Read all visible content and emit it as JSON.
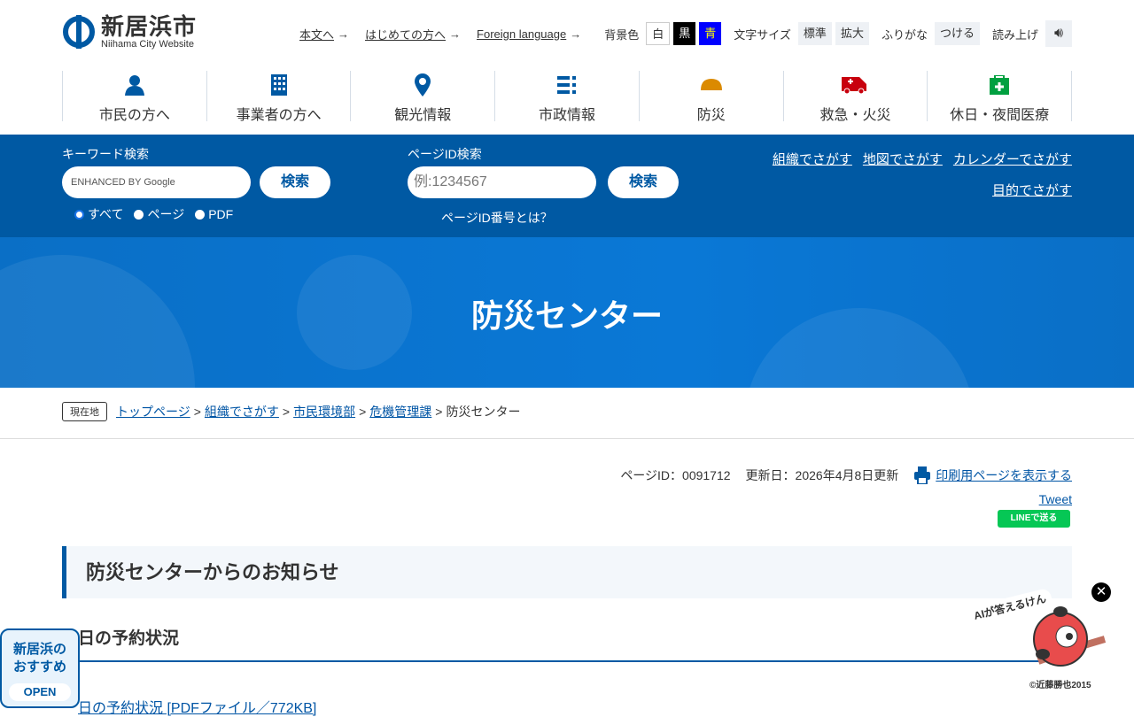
{
  "header": {
    "logo_title": "新居浜市",
    "logo_sub": "Niihama City Website",
    "util_links": [
      "本文へ",
      "はじめての方へ",
      "Foreign language"
    ],
    "bg_label": "背景色",
    "bg_options": [
      "白",
      "黒",
      "青"
    ],
    "size_label": "文字サイズ",
    "size_options": [
      "標準",
      "拡大"
    ],
    "furigana_label": "ふりがな",
    "furigana_btn": "つける",
    "read_label": "読み上げ"
  },
  "gnav": [
    {
      "label": "市民の方へ",
      "icon": "person-icon"
    },
    {
      "label": "事業者の方へ",
      "icon": "building-icon"
    },
    {
      "label": "観光情報",
      "icon": "map-pin-icon"
    },
    {
      "label": "市政情報",
      "icon": "list-icon"
    },
    {
      "label": "防災",
      "icon": "helmet-icon"
    },
    {
      "label": "救急・火災",
      "icon": "ambulance-icon"
    },
    {
      "label": "休日・夜間医療",
      "icon": "medical-kit-icon"
    }
  ],
  "search": {
    "keyword_label": "キーワード検索",
    "keyword_placeholder": "ENHANCED BY Google",
    "search_btn": "検索",
    "radios": [
      "すべて",
      "ページ",
      "PDF"
    ],
    "pageid_label": "ページID検索",
    "pageid_placeholder": "例:1234567",
    "pageid_btn": "検索",
    "pageid_help": "ページID番号とは？",
    "links": [
      "組織でさがす",
      "地図でさがす",
      "カレンダーでさがす",
      "目的でさがす"
    ]
  },
  "banner": {
    "title": "防災センター"
  },
  "breadcrumb": {
    "here": "現在地",
    "items": [
      "トップページ",
      "組織でさがす",
      "市民環境部",
      "危機管理課"
    ],
    "current": "防災センター",
    "sep": ">"
  },
  "meta": {
    "page_id": "ページID：0091712",
    "updated": "更新日：2026年4月8日更新",
    "print": "印刷用ページを表示する",
    "tweet": "Tweet",
    "line": "LINEで送る"
  },
  "content": {
    "h2": "防災センターからのお知らせ",
    "h3": "日の予約状況",
    "pdf_link": "日の予約状況 [PDFファイル／772KB]"
  },
  "reco": {
    "title": "新居浜のおすすめ",
    "open": "OPEN"
  },
  "ai": {
    "bubble": "AIが答えるけん",
    "copyright": "©近藤勝也2015"
  },
  "colors": {
    "primary": "#0059a3",
    "banner": "#0a72c8",
    "line": "#06c755"
  }
}
